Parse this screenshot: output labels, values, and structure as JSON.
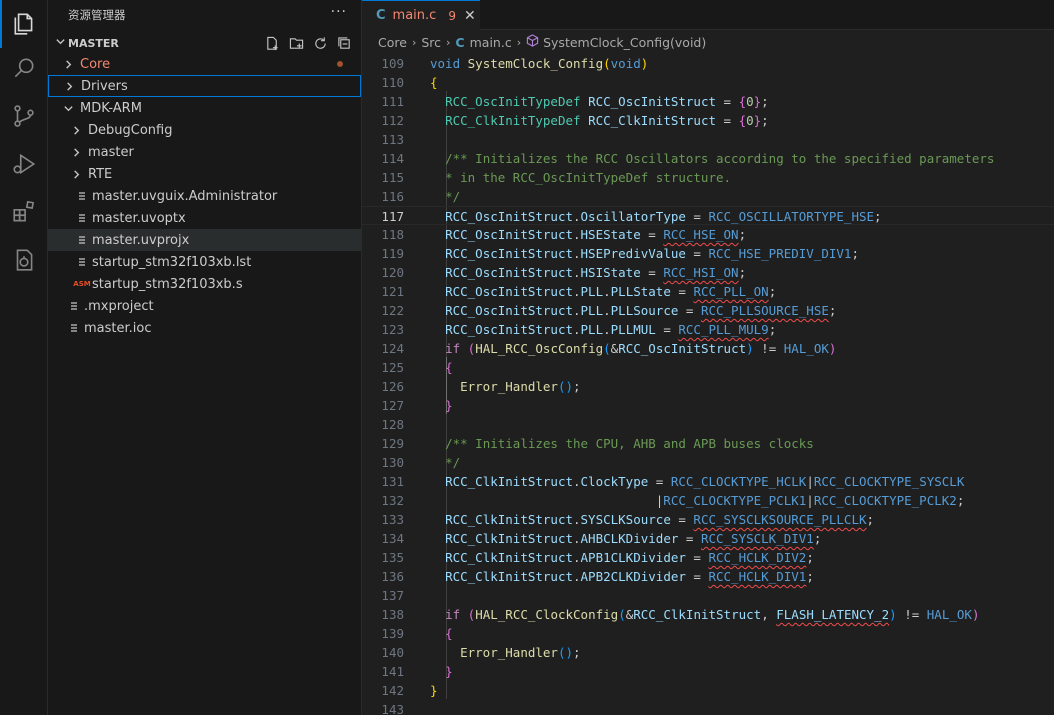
{
  "sidebar": {
    "title": "资源管理器",
    "more_label": "···",
    "section_title": "MASTER",
    "tree": [
      {
        "label": "Core",
        "kind": "folder",
        "expanded": false,
        "modified": true
      },
      {
        "label": "Drivers",
        "kind": "folder",
        "expanded": false
      },
      {
        "label": "MDK-ARM",
        "kind": "folder",
        "expanded": true
      },
      {
        "label": "DebugConfig",
        "kind": "folder",
        "expanded": false
      },
      {
        "label": "master",
        "kind": "folder",
        "expanded": false
      },
      {
        "label": "RTE",
        "kind": "folder",
        "expanded": false
      },
      {
        "label": "master.uvguix.Administrator",
        "kind": "file"
      },
      {
        "label": "master.uvoptx",
        "kind": "file"
      },
      {
        "label": "master.uvprojx",
        "kind": "file"
      },
      {
        "label": "startup_stm32f103xb.lst",
        "kind": "file"
      },
      {
        "label": "startup_stm32f103xb.s",
        "kind": "asm-file",
        "icon_text": "ASM"
      },
      {
        "label": ".mxproject",
        "kind": "file"
      },
      {
        "label": "master.ioc",
        "kind": "file"
      }
    ]
  },
  "tab": {
    "icon_text": "C",
    "filename": "main.c",
    "problem_count": "9",
    "close_glyph": "✕"
  },
  "breadcrumb": {
    "items": [
      "Core",
      "Src",
      "main.c",
      "SystemClock_Config(void)"
    ],
    "file_icon_text": "C"
  },
  "editor": {
    "current_line": "117",
    "line_numbers": [
      "109",
      "110",
      "111",
      "112",
      "113",
      "114",
      "115",
      "116",
      "117",
      "118",
      "119",
      "120",
      "121",
      "122",
      "123",
      "124",
      "125",
      "126",
      "127",
      "128",
      "129",
      "130",
      "131",
      "132",
      "133",
      "134",
      "135",
      "136",
      "137",
      "138",
      "139",
      "140",
      "141",
      "142",
      "143"
    ]
  },
  "colors": {
    "accent": "#0078d4",
    "error": "#f48771",
    "keyword": "#569cd6",
    "type": "#4ec9b0",
    "function": "#dcdcaa",
    "comment": "#6a9955"
  },
  "icons": {
    "activity": [
      "files-icon",
      "search-icon",
      "source-control-icon",
      "run-debug-icon",
      "extensions-icon",
      "stm32-cube-icon"
    ]
  }
}
